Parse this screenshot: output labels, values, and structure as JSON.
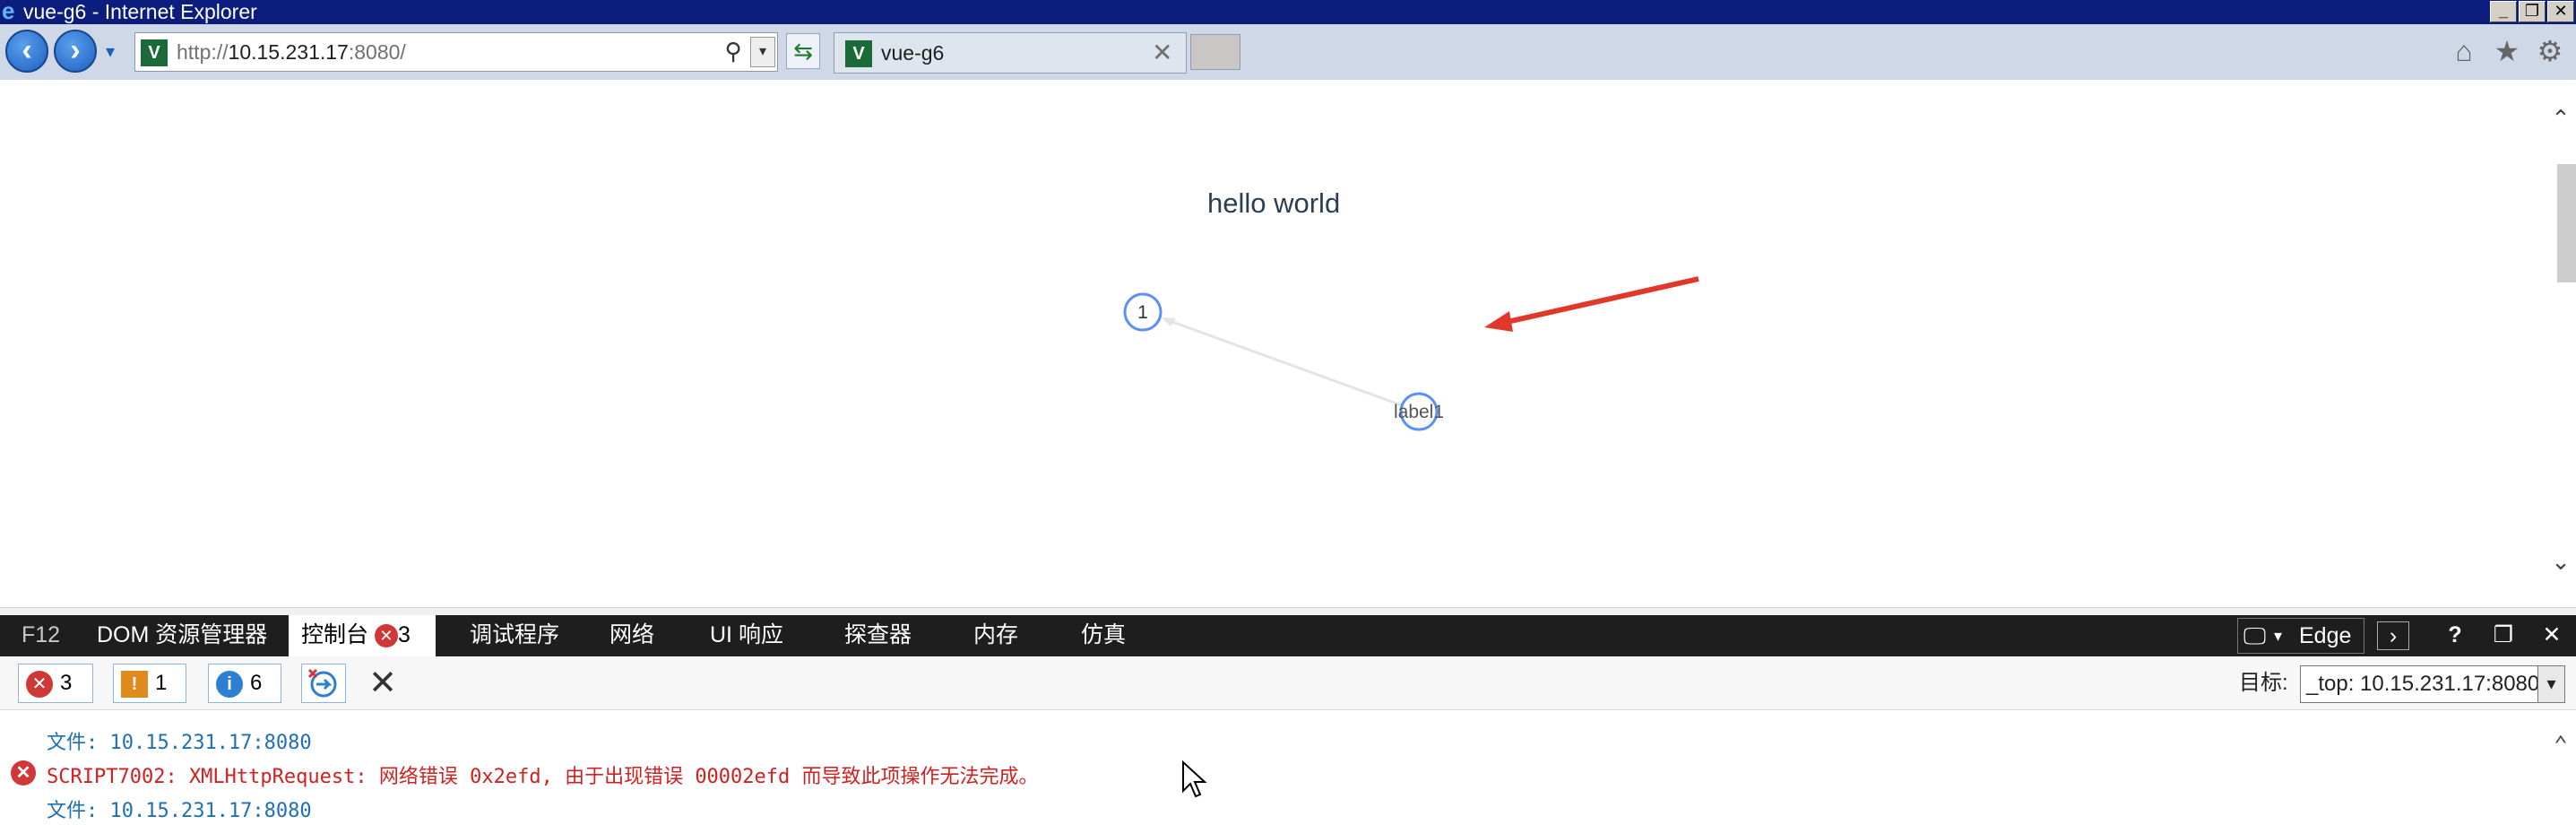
{
  "window": {
    "title": "vue-g6 - Internet Explorer"
  },
  "browser": {
    "address_url_prefix": "http://",
    "address_url_host": "10.15.231.17",
    "address_url_rest": ":8080/",
    "tab_title": "vue-g6"
  },
  "page": {
    "heading": "hello world",
    "graph": {
      "nodes": [
        {
          "id": "1",
          "label": "1"
        },
        {
          "id": "label1",
          "label": "label1"
        }
      ],
      "edges": [
        {
          "source": "label1",
          "target": "1"
        }
      ]
    },
    "annotation": {
      "color": "#e0392b",
      "icon": "red-arrow"
    }
  },
  "devtools": {
    "tabs": {
      "f12": "F12",
      "dom": "DOM 资源管理器",
      "console": "控制台",
      "console_errors": "3",
      "debugger": "调试程序",
      "network": "网络",
      "ui": "UI 响应",
      "profiler": "探查器",
      "memory": "内存",
      "emulation": "仿真"
    },
    "mode": "Edge",
    "help": "?",
    "counts": {
      "errors": "3",
      "warnings": "1",
      "info": "6"
    },
    "target_label": "目标:",
    "target_value": "_top: 10.15.231.17:8080",
    "console_lines": [
      {
        "kind": "file",
        "text": "文件: 10.15.231.17:8080"
      },
      {
        "kind": "error",
        "text": "SCRIPT7002: XMLHttpRequest: 网络错误 0x2efd, 由于出现错误 00002efd 而导致此项操作无法完成。"
      },
      {
        "kind": "file",
        "text": "文件: 10.15.231.17:8080"
      }
    ]
  }
}
